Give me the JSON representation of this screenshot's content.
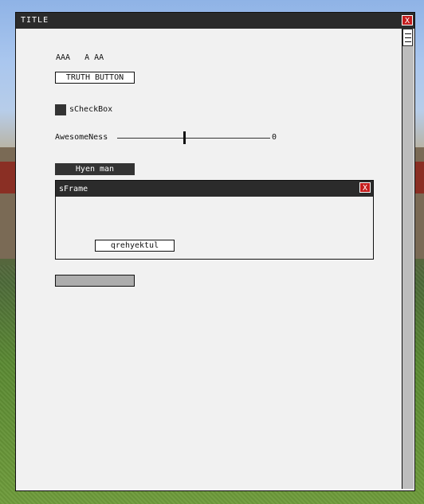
{
  "window": {
    "title": "TITLE",
    "close_label": "X"
  },
  "labels": {
    "aaa": "AAA   A AA"
  },
  "truth_button": {
    "label": "TRUTH BUTTON"
  },
  "checkbox": {
    "label": "sCheckBox",
    "checked": false
  },
  "slider": {
    "label": "AwesomeNess",
    "value": "0",
    "position_fraction": 0.5
  },
  "dark_button": {
    "label": "Hyen man"
  },
  "sub_frame": {
    "title": "sFrame",
    "close_label": "X",
    "button_label": "qrehyektul"
  },
  "progress": {
    "value_fraction": 0
  },
  "colors": {
    "titlebar": "#2b2b2b",
    "close": "#c31d1d",
    "panel": "#f1f1f1"
  }
}
